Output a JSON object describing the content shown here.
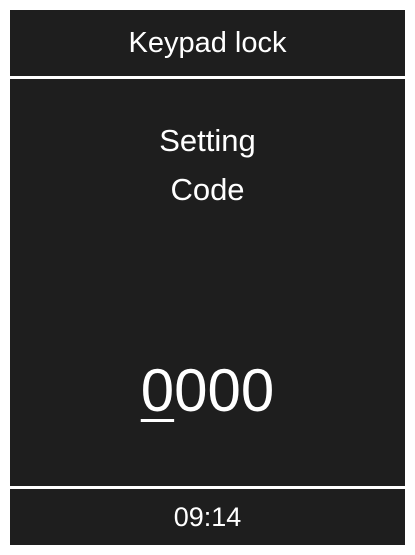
{
  "header": {
    "title": "Keypad lock"
  },
  "main": {
    "label_line1": "Setting",
    "label_line2": "Code",
    "code_digits": [
      "0",
      "0",
      "0",
      "0"
    ],
    "active_digit_index": 0
  },
  "footer": {
    "time": "09:14"
  },
  "colors": {
    "background": "#1e1e1e",
    "foreground": "#ffffff",
    "frame": "#ffffff"
  }
}
